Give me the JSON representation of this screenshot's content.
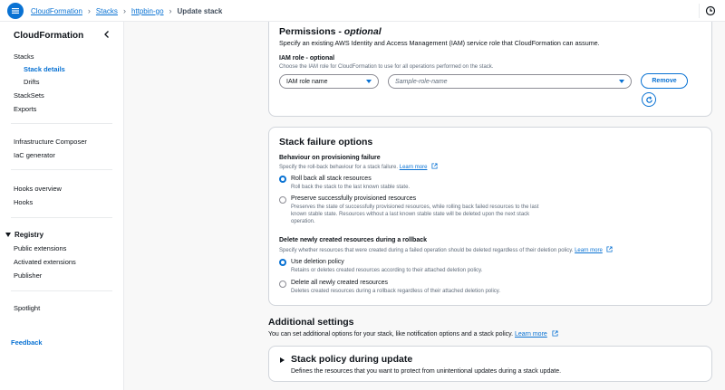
{
  "breadcrumb": {
    "items": [
      "CloudFormation",
      "Stacks",
      "httpbin-go"
    ],
    "current": "Update stack"
  },
  "sidebar": {
    "title": "CloudFormation",
    "items": {
      "stacks": "Stacks",
      "stack_details": "Stack details",
      "drifts": "Drifts",
      "stacksets": "StackSets",
      "exports": "Exports",
      "infra_composer": "Infrastructure Composer",
      "iac_generator": "IaC generator",
      "hooks_overview": "Hooks overview",
      "hooks": "Hooks",
      "registry": "Registry",
      "public_extensions": "Public extensions",
      "activated_extensions": "Activated extensions",
      "publisher": "Publisher",
      "spotlight": "Spotlight",
      "feedback": "Feedback"
    }
  },
  "permissions": {
    "title": "Permissions - ",
    "title_optional": "optional",
    "description": "Specify an existing AWS Identity and Access Management (IAM) service role that CloudFormation can assume.",
    "iam_label": "IAM role - optional",
    "iam_desc": "Choose the IAM role for CloudFormation to use for all operations performed on the stack.",
    "role_type_value": "IAM role name",
    "role_name_placeholder": "Sample-role-name",
    "remove_label": "Remove"
  },
  "failure": {
    "title": "Stack failure options",
    "behaviour_label": "Behaviour on provisioning failure",
    "behaviour_desc": "Specify the roll-back behaviour for a stack failure.",
    "learn_more": "Learn more",
    "opt1_label": "Roll back all stack resources",
    "opt1_desc": "Roll back the stack to the last known stable state.",
    "opt2_label": "Preserve successfully provisioned resources",
    "opt2_desc1": "Preserves the state of successfully provisioned resources, while rolling back failed resources to the last",
    "opt2_desc2": "known stable state. Resources without a last known stable state will be deleted upon the next stack",
    "opt2_desc3": "operation.",
    "delete_label": "Delete newly created resources during a rollback",
    "delete_desc": "Specify whether resources that were created during a failed operation should be deleted regardless of their deletion policy.",
    "opt3_label": "Use deletion policy",
    "opt3_desc": "Retains or deletes created resources according to their attached deletion policy.",
    "opt4_label": "Delete all newly created resources",
    "opt4_desc": "Deletes created resources during a rollback regardless of their attached deletion policy."
  },
  "additional": {
    "title": "Additional settings",
    "desc": "You can set additional options for your stack, like notification options and a stack policy.",
    "learn_more": "Learn more",
    "policy_title": "Stack policy during update",
    "policy_desc": "Defines the resources that you want to protect from unintentional updates during a stack update."
  },
  "colors": {
    "accent": "#0972d3",
    "text": "#0f141a",
    "muted": "#5f6b7a",
    "border": "#d1d5db"
  }
}
